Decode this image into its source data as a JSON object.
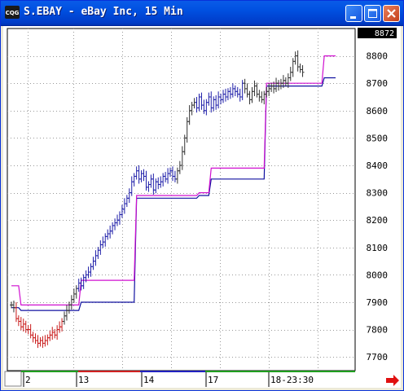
{
  "window": {
    "title": "S.EBAY - eBay Inc, 15 Min",
    "icon": "cqg-app-icon",
    "controls": [
      "minimize",
      "maximize",
      "close"
    ]
  },
  "chart_data": {
    "type": "bar",
    "symbol": "S.EBAY",
    "ylim": [
      7650,
      8900
    ],
    "yticks": [
      "7700",
      "7800",
      "7900",
      "8000",
      "8100",
      "8200",
      "8300",
      "8400",
      "8500",
      "8600",
      "8700",
      "8800"
    ],
    "last_price": "8872",
    "date_labels": [
      "2",
      "13",
      "14",
      "17",
      "18-23:30"
    ],
    "grid": true,
    "colors": {
      "up": "#1c1ca8",
      "down": "#c81818",
      "neutral": "#303030",
      "upper_band": "#d010d0",
      "lower_band": "#1010a0",
      "last_box_bg": "#000000"
    },
    "upper_band": [
      [
        0,
        7960
      ],
      [
        3,
        7960
      ],
      [
        4,
        7890
      ],
      [
        28,
        7890
      ],
      [
        29,
        7980
      ],
      [
        51,
        7980
      ],
      [
        52,
        8290
      ],
      [
        77,
        8290
      ],
      [
        78,
        8300
      ],
      [
        82,
        8300
      ],
      [
        83,
        8390
      ],
      [
        105,
        8390
      ],
      [
        106,
        8700
      ],
      [
        129,
        8700
      ],
      [
        130,
        8800
      ],
      [
        134,
        8800
      ]
    ],
    "lower_band": [
      [
        0,
        7880
      ],
      [
        3,
        7880
      ],
      [
        4,
        7870
      ],
      [
        28,
        7870
      ],
      [
        29,
        7900
      ],
      [
        51,
        7900
      ],
      [
        52,
        8280
      ],
      [
        77,
        8280
      ],
      [
        78,
        8290
      ],
      [
        82,
        8290
      ],
      [
        83,
        8350
      ],
      [
        105,
        8350
      ],
      [
        106,
        8690
      ],
      [
        129,
        8690
      ],
      [
        130,
        8720
      ],
      [
        134,
        8720
      ]
    ],
    "segments": [
      {
        "color": "neutral",
        "closes": [
          7890,
          7880
        ]
      },
      {
        "color": "down",
        "closes": [
          7840,
          7830,
          7810,
          7820,
          7800,
          7800,
          7780,
          7770,
          7760,
          7750,
          7760,
          7750,
          7760,
          7770,
          7780,
          7790,
          7780,
          7800,
          7810,
          7830
        ]
      },
      {
        "color": "neutral",
        "closes": [
          7850,
          7870,
          7890,
          7910,
          7930,
          7950
        ]
      },
      {
        "color": "up",
        "closes": [
          7970,
          7960,
          7990,
          8000,
          8010,
          8030,
          8050,
          8070,
          8090,
          8110,
          8120,
          8140,
          8150,
          8160,
          8180,
          8190,
          8200,
          8220,
          8240,
          8260,
          8280
        ]
      },
      {
        "color": "up",
        "closes": [
          8300,
          8340,
          8360,
          8380,
          8350,
          8370,
          8360,
          8320,
          8330,
          8350,
          8310,
          8340,
          8330,
          8340,
          8360,
          8350,
          8370,
          8380,
          8360,
          8350
        ]
      },
      {
        "color": "neutral",
        "closes": [
          8380,
          8400,
          8450,
          8500,
          8560,
          8600,
          8620,
          8630
        ]
      },
      {
        "color": "up",
        "closes": [
          8610,
          8650,
          8620,
          8600,
          8630,
          8650,
          8610,
          8640,
          8620,
          8650,
          8640,
          8660,
          8650,
          8670,
          8660,
          8680,
          8670,
          8660,
          8650,
          8700
        ]
      },
      {
        "color": "neutral",
        "closes": [
          8680,
          8660,
          8640,
          8670,
          8690,
          8660,
          8650,
          8640,
          8660,
          8670,
          8680,
          8690,
          8680,
          8700,
          8690,
          8700,
          8710,
          8700,
          8720,
          8740,
          8780,
          8800,
          8760,
          8750,
          8740
        ]
      }
    ]
  }
}
